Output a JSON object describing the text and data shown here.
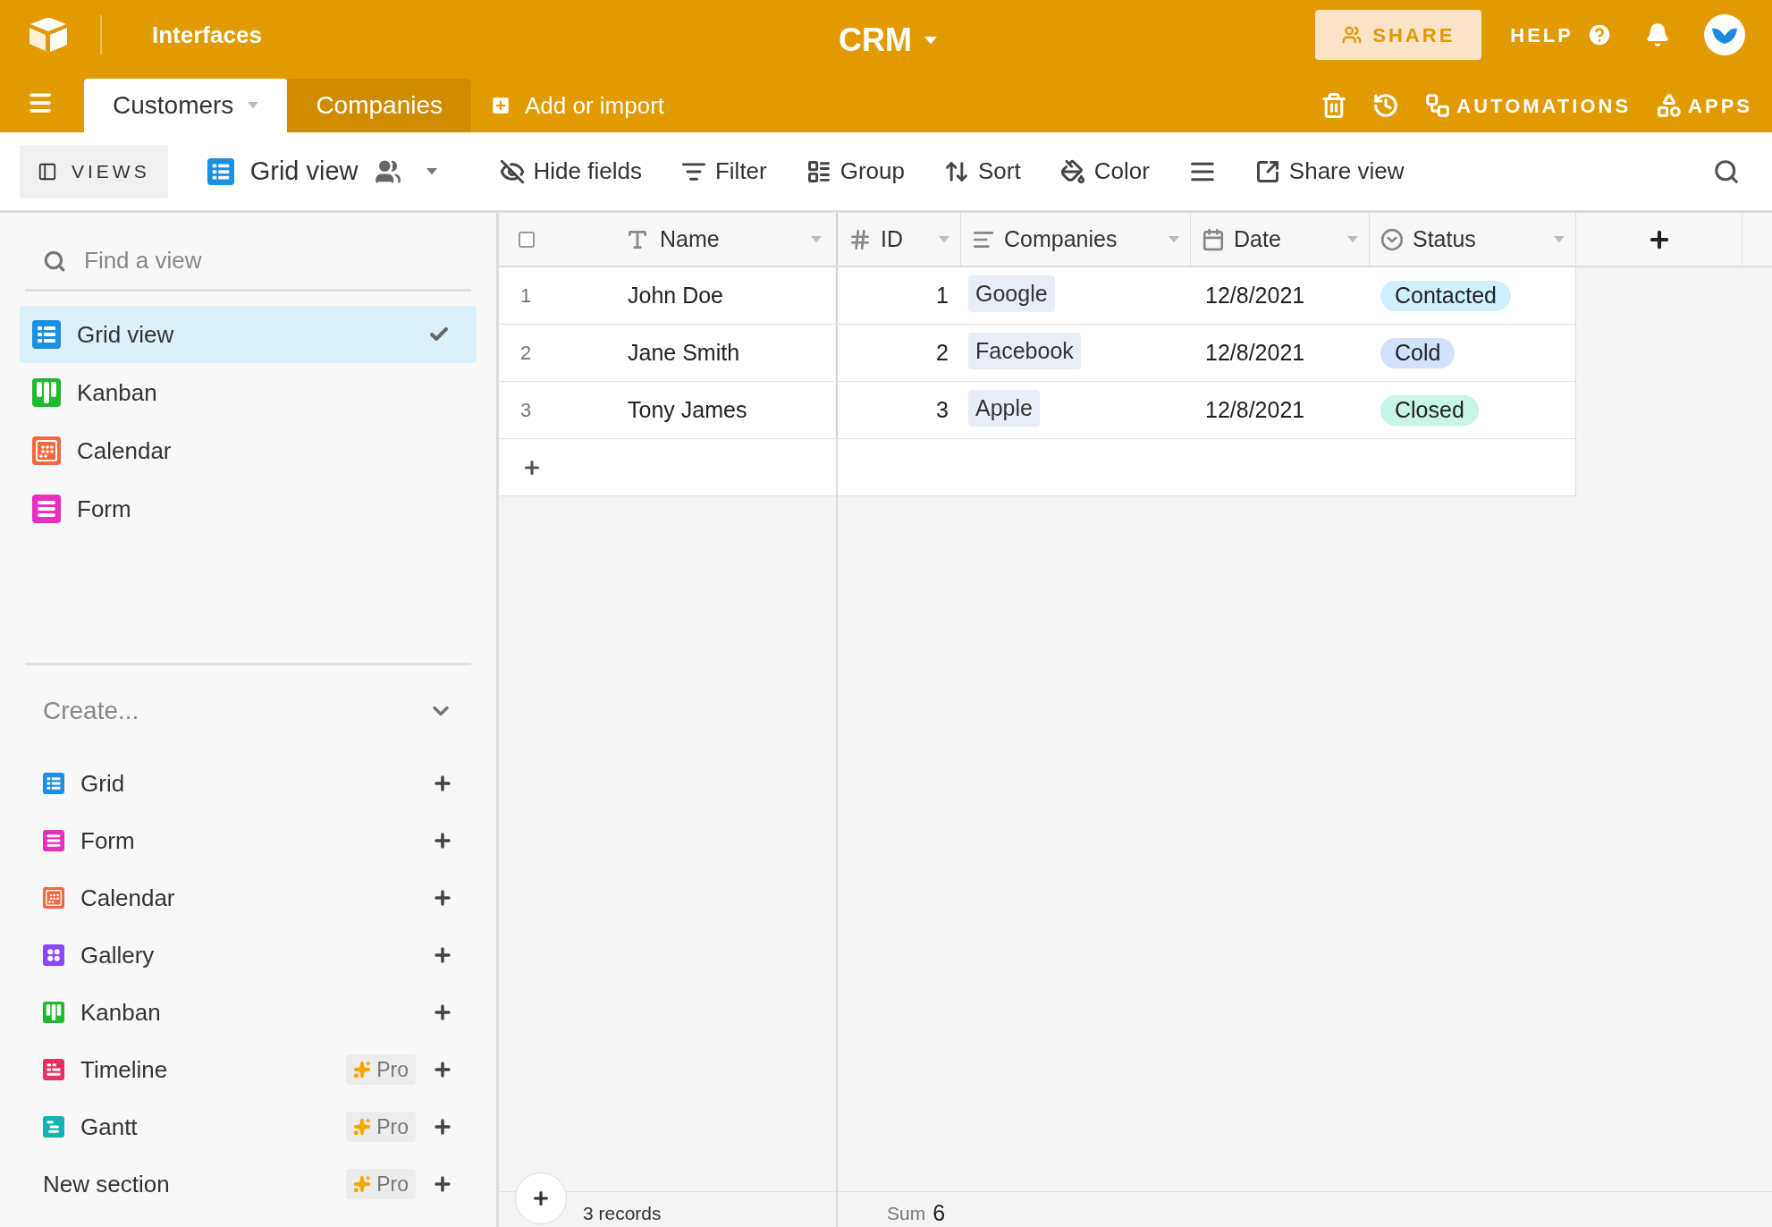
{
  "app_bar": {
    "interfaces_link": "Interfaces",
    "base_name": "CRM",
    "share_button": "SHARE",
    "help_button": "HELP"
  },
  "table_tabs": [
    {
      "label": "Customers",
      "selected": true
    },
    {
      "label": "Companies",
      "selected": false
    }
  ],
  "add_table": "Add or import",
  "base_actions": [
    {
      "kind": "trash"
    },
    {
      "kind": "history"
    },
    {
      "kind": "automations",
      "label": "AUTOMATIONS"
    },
    {
      "kind": "apps",
      "label": "APPS"
    }
  ],
  "view_bar": {
    "views_button": "VIEWS",
    "current_view": "Grid view",
    "tools": [
      {
        "kind": "hide",
        "label": "Hide fields"
      },
      {
        "kind": "filter",
        "label": "Filter"
      },
      {
        "kind": "group",
        "label": "Group"
      },
      {
        "kind": "sort",
        "label": "Sort"
      },
      {
        "kind": "color",
        "label": "Color"
      },
      {
        "kind": "row-height"
      },
      {
        "kind": "share",
        "label": "Share view"
      }
    ]
  },
  "sidebar": {
    "search": {
      "placeholder": "Find a view"
    },
    "views": [
      {
        "label": "Grid view",
        "kind": "grid",
        "selected": true
      },
      {
        "label": "Kanban",
        "kind": "kanban",
        "selected": false
      },
      {
        "label": "Calendar",
        "kind": "calendar",
        "selected": false
      },
      {
        "label": "Form",
        "kind": "form",
        "selected": false
      }
    ],
    "create": {
      "title": "Create...",
      "expanded": true,
      "items": [
        {
          "label": "Grid",
          "kind": "grid"
        },
        {
          "label": "Form",
          "kind": "form"
        },
        {
          "label": "Calendar",
          "kind": "calendar"
        },
        {
          "label": "Gallery",
          "kind": "gallery"
        },
        {
          "label": "Kanban",
          "kind": "kanban"
        },
        {
          "label": "Timeline",
          "kind": "timeline",
          "badge": "Pro"
        },
        {
          "label": "Gantt",
          "kind": "gantt",
          "badge": "Pro"
        },
        {
          "label": "New section",
          "kind": "section",
          "badge": "Pro"
        }
      ]
    }
  },
  "table": {
    "select_all": {
      "checked": false
    },
    "columns": [
      {
        "label": "Name",
        "kind": "text"
      },
      {
        "label": "ID",
        "kind": "number"
      },
      {
        "label": "Companies",
        "kind": "link"
      },
      {
        "label": "Date",
        "kind": "date"
      },
      {
        "label": "Status",
        "kind": "select"
      }
    ],
    "rows": [
      {
        "number": "1",
        "name": "John Doe",
        "id": "1",
        "company": "Google",
        "date": "12/8/2021",
        "status": {
          "label": "Contacted",
          "color": "#d0f0fd"
        }
      },
      {
        "number": "2",
        "name": "Jane Smith",
        "id": "2",
        "company": "Facebook",
        "date": "12/8/2021",
        "status": {
          "label": "Cold",
          "color": "#d0e2fd"
        }
      },
      {
        "number": "3",
        "name": "Tony James",
        "id": "3",
        "company": "Apple",
        "date": "12/8/2021",
        "status": {
          "label": "Closed",
          "color": "#c7f5e8"
        }
      }
    ],
    "footer": {
      "records": "3 records",
      "sum_label": "Sum",
      "sum_value": "6"
    }
  }
}
